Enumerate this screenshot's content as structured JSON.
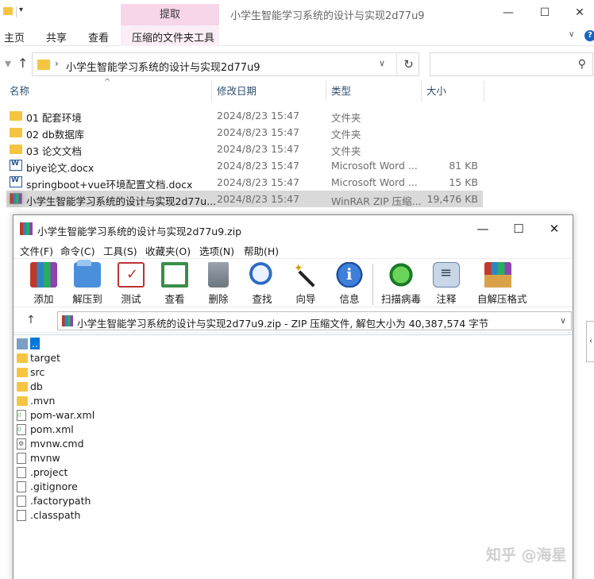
{
  "explorer": {
    "title": "小学生智能学习系统的设计与实现2d77u9",
    "context_tab": "提取",
    "ribbon_tabs": [
      "主页",
      "共享",
      "查看",
      "压缩的文件夹工具"
    ],
    "address": "小学生智能学习系统的设计与实现2d77u9",
    "search_placeholder": "",
    "columns": {
      "name": "名称",
      "date": "修改日期",
      "type": "类型",
      "size": "大小"
    },
    "files": [
      {
        "name": "01 配套环境",
        "date": "2024/8/23 15:47",
        "type": "文件夹",
        "size": "",
        "icon": "folder-icon"
      },
      {
        "name": "02 db数据库",
        "date": "2024/8/23 15:47",
        "type": "文件夹",
        "size": "",
        "icon": "folder-icon"
      },
      {
        "name": "03 论文文档",
        "date": "2024/8/23 15:47",
        "type": "文件夹",
        "size": "",
        "icon": "folder-icon"
      },
      {
        "name": "biye论文.docx",
        "date": "2024/8/23 15:47",
        "type": "Microsoft Word ...",
        "size": "81 KB",
        "icon": "word-icon"
      },
      {
        "name": "springboot+vue环境配置文档.docx",
        "date": "2024/8/23 15:47",
        "type": "Microsoft Word ...",
        "size": "15 KB",
        "icon": "word-icon"
      },
      {
        "name": "小学生智能学习系统的设计与实现2d77u...",
        "date": "2024/8/23 15:47",
        "type": "WinRAR ZIP 压缩...",
        "size": "19,476 KB",
        "icon": "winrar-icon"
      }
    ]
  },
  "winrar": {
    "title": "小学生智能学习系统的设计与实现2d77u9.zip",
    "menu": [
      "文件(F)",
      "命令(C)",
      "工具(S)",
      "收藏夹(O)",
      "选项(N)",
      "帮助(H)"
    ],
    "toolbar": [
      "添加",
      "解压到",
      "测试",
      "查看",
      "删除",
      "查找",
      "向导",
      "信息",
      "扫描病毒",
      "注释",
      "自解压格式"
    ],
    "path": "小学生智能学习系统的设计与实现2d77u9.zip - ZIP 压缩文件, 解包大小为 40,387,574 字节",
    "entries": [
      {
        "name": "..",
        "icon": "up-folder-icon"
      },
      {
        "name": "target",
        "icon": "folder-icon"
      },
      {
        "name": "src",
        "icon": "folder-icon"
      },
      {
        "name": "db",
        "icon": "folder-icon"
      },
      {
        "name": ".mvn",
        "icon": "folder-icon"
      },
      {
        "name": "pom-war.xml",
        "icon": "xml-file-icon"
      },
      {
        "name": "pom.xml",
        "icon": "xml-file-icon"
      },
      {
        "name": "mvnw.cmd",
        "icon": "cmd-file-icon"
      },
      {
        "name": "mvnw",
        "icon": "file-icon"
      },
      {
        "name": ".project",
        "icon": "file-icon"
      },
      {
        "name": ".gitignore",
        "icon": "file-icon"
      },
      {
        "name": ".factorypath",
        "icon": "file-icon"
      },
      {
        "name": ".classpath",
        "icon": "file-icon"
      }
    ]
  },
  "watermark": "知乎 @海星",
  "colors": {
    "context_tab": "#f7d6ea",
    "selection": "#0078d7",
    "folder": "#f5c542"
  }
}
